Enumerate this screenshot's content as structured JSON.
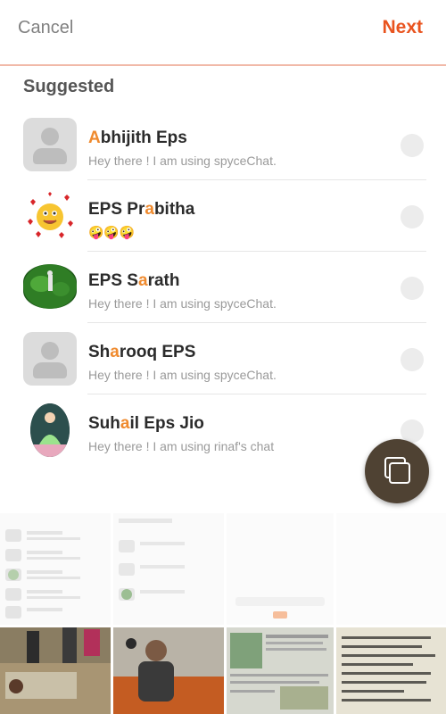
{
  "header": {
    "cancel_label": "Cancel",
    "next_label": "Next"
  },
  "section_title": "Suggested",
  "contacts": [
    {
      "name_hl": "A",
      "name_rest": "bhijith Eps",
      "name_pre": "",
      "status": "Hey there ! I am using spyceChat."
    },
    {
      "name_pre": "EPS Pr",
      "name_hl": "a",
      "name_rest": "bitha",
      "status": "🤪🤪🤪"
    },
    {
      "name_pre": "EPS S",
      "name_hl": "a",
      "name_rest": "rath",
      "status": "Hey there ! I am using spyceChat."
    },
    {
      "name_pre": "Sh",
      "name_hl": "a",
      "name_rest": "rooq EPS",
      "status": "Hey there ! I am using spyceChat."
    },
    {
      "name_pre": "Suh",
      "name_hl": "a",
      "name_rest": "il Eps Jio",
      "status": "Hey there ! I am using rinaf's chat"
    }
  ],
  "fab_icon": "copy-icon",
  "colors": {
    "accent": "#e9541f",
    "highlight": "#ef8a2e",
    "fab": "#4f4233"
  }
}
